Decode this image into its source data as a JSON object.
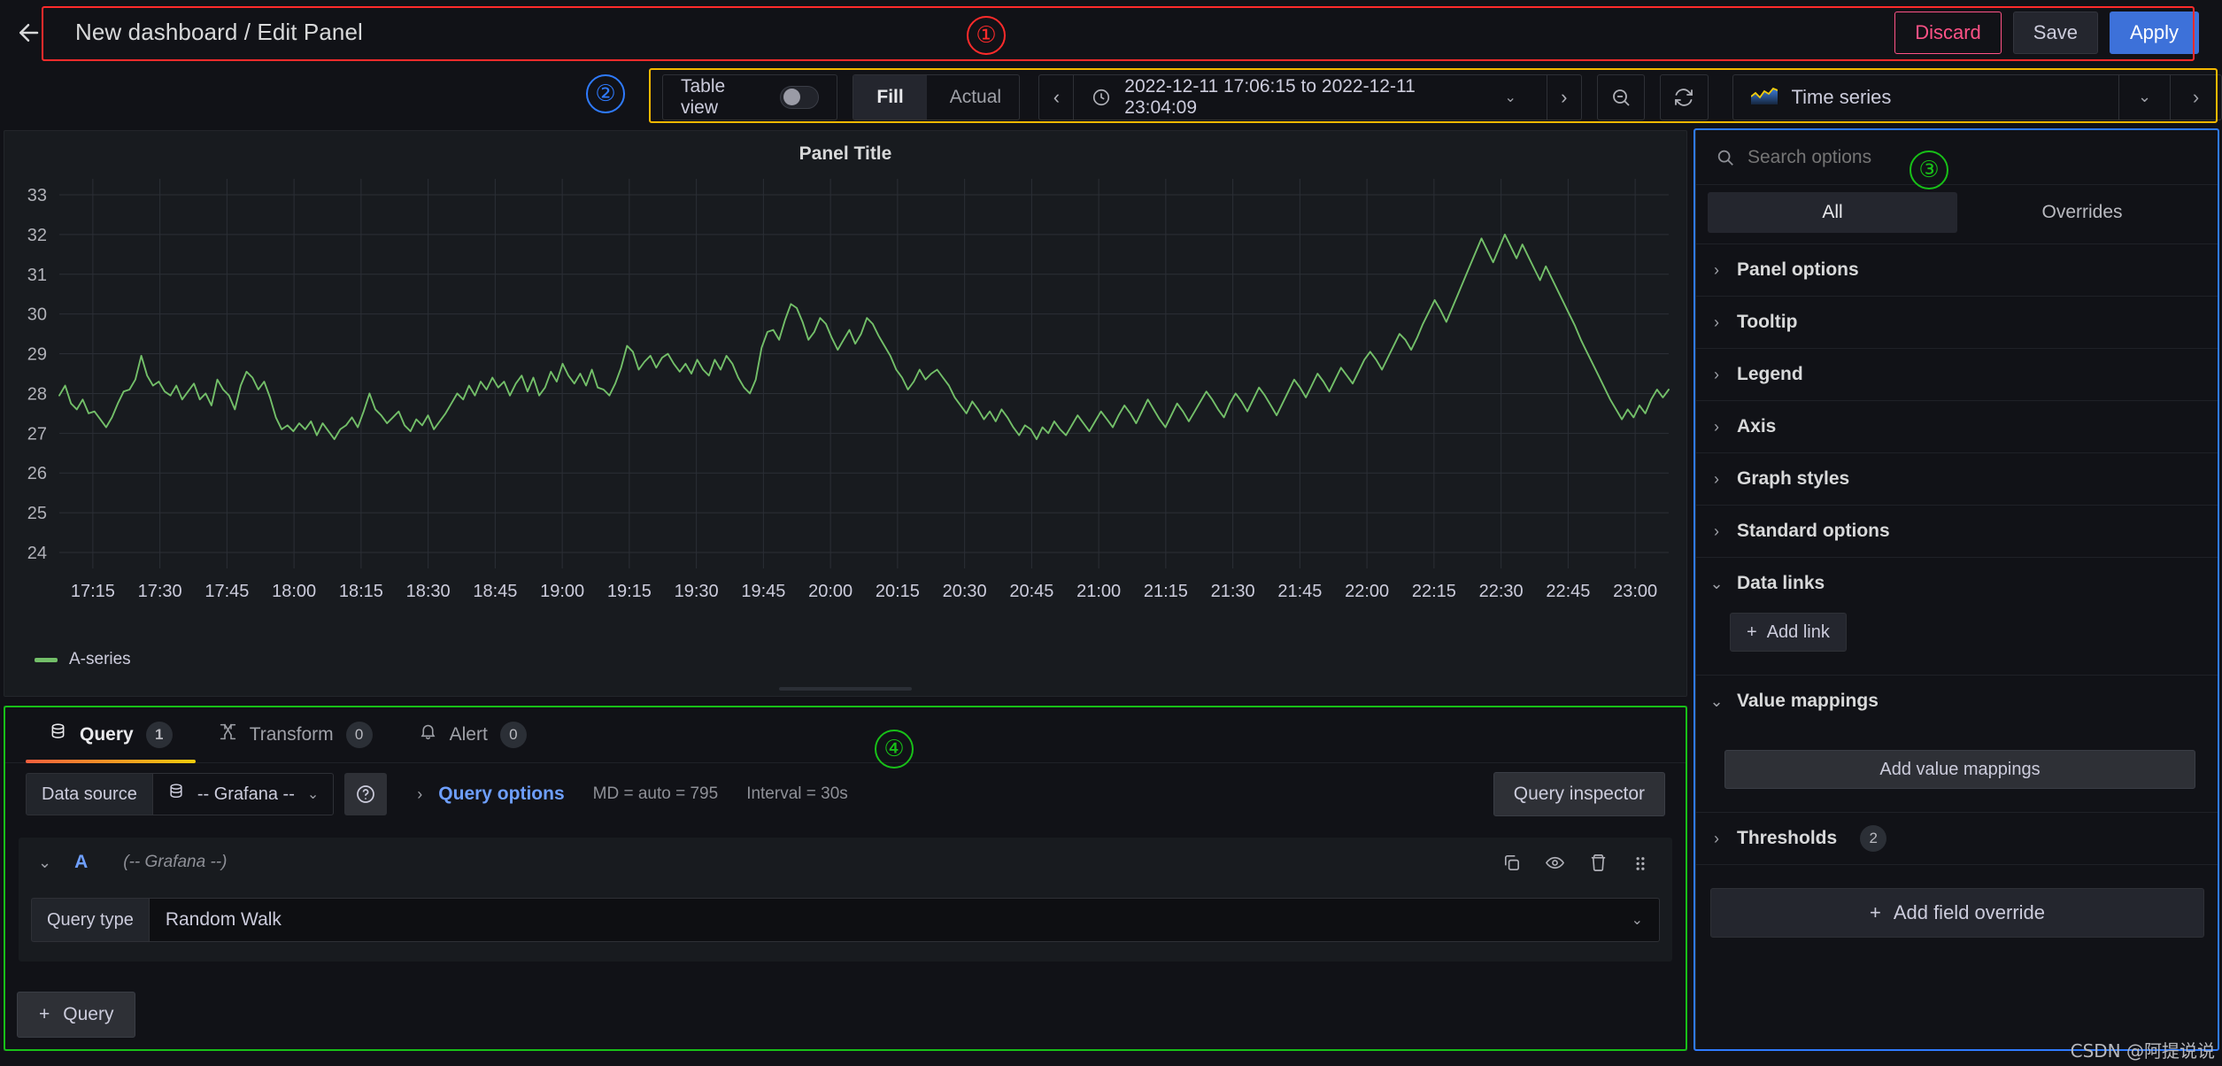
{
  "header": {
    "back_icon": "arrow-left-icon",
    "title": "New dashboard / Edit Panel",
    "discard_label": "Discard",
    "save_label": "Save",
    "apply_label": "Apply",
    "accent_apply": "#3d71d9",
    "accent_discard": "#ff5286"
  },
  "toolbar": {
    "table_view_label": "Table view",
    "table_view_on": false,
    "fill_label": "Fill",
    "actual_label": "Actual",
    "fill_active": true,
    "prev_arrow": "‹",
    "next_arrow": "›",
    "clock_icon": "clock-icon",
    "time_range": "2022-12-11 17:06:15 to 2022-12-11 23:04:09",
    "time_caret": "⌄",
    "zoom_out_icon": "zoom-out-icon",
    "refresh_icon": "refresh-icon",
    "viz_type": "Time series",
    "viz_icon": "timeseries-icon",
    "viz_caret": "⌄",
    "viz_next": "›"
  },
  "panel": {
    "title": "Panel Title"
  },
  "chart_data": {
    "type": "line",
    "title": "Panel Title",
    "xlabel": "",
    "ylabel": "",
    "ylim": [
      23.6,
      33.4
    ],
    "yticks": [
      24,
      25,
      26,
      27,
      28,
      29,
      30,
      31,
      32,
      33
    ],
    "xticks": [
      "17:15",
      "17:30",
      "17:45",
      "18:00",
      "18:15",
      "18:30",
      "18:45",
      "19:00",
      "19:15",
      "19:30",
      "19:45",
      "20:00",
      "20:15",
      "20:30",
      "20:45",
      "21:00",
      "21:15",
      "21:30",
      "21:45",
      "22:00",
      "22:15",
      "22:30",
      "22:45",
      "23:00"
    ],
    "grid": true,
    "legend_position": "bottom-left",
    "series": [
      {
        "name": "A-series",
        "color": "#73bf69",
        "values": [
          27.95,
          28.2,
          27.75,
          27.6,
          27.85,
          27.5,
          27.55,
          27.35,
          27.15,
          27.4,
          27.75,
          28.05,
          28.1,
          28.35,
          28.95,
          28.45,
          28.2,
          28.3,
          28.05,
          27.95,
          28.2,
          27.85,
          28.05,
          28.25,
          27.85,
          28.0,
          27.7,
          28.35,
          28.1,
          27.95,
          27.6,
          28.2,
          28.55,
          28.4,
          28.1,
          28.3,
          27.9,
          27.4,
          27.1,
          27.2,
          27.05,
          27.25,
          27.1,
          27.3,
          26.95,
          27.25,
          27.05,
          26.85,
          27.1,
          27.2,
          27.4,
          27.15,
          27.55,
          28.0,
          27.6,
          27.45,
          27.25,
          27.4,
          27.55,
          27.2,
          27.05,
          27.35,
          27.2,
          27.45,
          27.1,
          27.3,
          27.5,
          27.75,
          28.0,
          27.85,
          28.2,
          27.95,
          28.3,
          28.1,
          28.4,
          28.15,
          28.3,
          27.95,
          28.25,
          28.45,
          28.05,
          28.4,
          27.95,
          28.15,
          28.55,
          28.3,
          28.75,
          28.45,
          28.25,
          28.5,
          28.2,
          28.6,
          28.15,
          28.1,
          27.95,
          28.25,
          28.65,
          29.2,
          29.05,
          28.6,
          28.8,
          28.95,
          28.65,
          28.9,
          29.0,
          28.75,
          28.55,
          28.75,
          28.5,
          28.85,
          28.6,
          28.45,
          28.85,
          28.6,
          28.95,
          28.75,
          28.4,
          28.15,
          28.0,
          28.35,
          29.15,
          29.55,
          29.6,
          29.35,
          29.85,
          30.25,
          30.15,
          29.8,
          29.35,
          29.55,
          29.9,
          29.75,
          29.4,
          29.1,
          29.35,
          29.6,
          29.25,
          29.5,
          29.9,
          29.75,
          29.45,
          29.2,
          28.95,
          28.6,
          28.4,
          28.1,
          28.3,
          28.6,
          28.35,
          28.5,
          28.6,
          28.4,
          28.2,
          27.9,
          27.7,
          27.5,
          27.8,
          27.6,
          27.35,
          27.55,
          27.3,
          27.6,
          27.4,
          27.15,
          26.95,
          27.2,
          27.1,
          26.85,
          27.15,
          27.0,
          27.3,
          27.1,
          26.95,
          27.2,
          27.45,
          27.25,
          27.05,
          27.3,
          27.55,
          27.35,
          27.15,
          27.45,
          27.7,
          27.5,
          27.25,
          27.55,
          27.85,
          27.6,
          27.35,
          27.15,
          27.45,
          27.75,
          27.55,
          27.3,
          27.55,
          27.8,
          28.05,
          27.85,
          27.6,
          27.4,
          27.75,
          28.0,
          27.8,
          27.55,
          27.85,
          28.15,
          27.95,
          27.7,
          27.45,
          27.75,
          28.05,
          28.35,
          28.15,
          27.9,
          28.2,
          28.5,
          28.3,
          28.05,
          28.35,
          28.65,
          28.45,
          28.25,
          28.55,
          28.85,
          29.05,
          28.85,
          28.6,
          28.9,
          29.2,
          29.5,
          29.35,
          29.1,
          29.4,
          29.75,
          30.05,
          30.35,
          30.1,
          29.8,
          30.15,
          30.5,
          30.85,
          31.2,
          31.55,
          31.9,
          31.6,
          31.3,
          31.65,
          32.0,
          31.7,
          31.4,
          31.75,
          31.45,
          31.15,
          30.85,
          31.2,
          30.9,
          30.6,
          30.3,
          30.0,
          29.7,
          29.35,
          29.05,
          28.75,
          28.45,
          28.15,
          27.85,
          27.6,
          27.35,
          27.6,
          27.4,
          27.7,
          27.5,
          27.85,
          28.1,
          27.9,
          28.1
        ]
      }
    ]
  },
  "options": {
    "search_placeholder": "Search options",
    "search_value": "",
    "search_icon": "search-icon",
    "tab_all": "All",
    "tab_overrides": "Overrides",
    "active_tab": "All",
    "sections": [
      {
        "label": "Panel options",
        "expanded": false
      },
      {
        "label": "Tooltip",
        "expanded": false
      },
      {
        "label": "Legend",
        "expanded": false
      },
      {
        "label": "Axis",
        "expanded": false
      },
      {
        "label": "Graph styles",
        "expanded": false
      },
      {
        "label": "Standard options",
        "expanded": false
      },
      {
        "label": "Data links",
        "expanded": true,
        "button": "Add link"
      },
      {
        "label": "Value mappings",
        "expanded": true,
        "button": "Add value mappings"
      },
      {
        "label": "Thresholds",
        "expanded": false,
        "badge": "2"
      }
    ],
    "add_field_override": "Add field override"
  },
  "query_pane": {
    "tabs": [
      {
        "label": "Query",
        "count": "1",
        "icon": "database-icon",
        "active": true
      },
      {
        "label": "Transform",
        "count": "0",
        "icon": "transform-icon",
        "active": false
      },
      {
        "label": "Alert",
        "count": "0",
        "icon": "bell-icon",
        "active": false
      }
    ],
    "data_source_label": "Data source",
    "data_source_value": "-- Grafana --",
    "data_source_icon": "database-icon",
    "help_icon": "help-circle-icon",
    "query_options_label": "Query options",
    "query_options_caret": "›",
    "max_data_points": "MD = auto = 795",
    "interval": "Interval = 30s",
    "query_inspector_label": "Query inspector",
    "rows": [
      {
        "ref_id": "A",
        "data_source": "(-- Grafana --)",
        "query_type_label": "Query type",
        "query_type_value": "Random Walk",
        "actions": [
          "copy-icon",
          "eye-icon",
          "trash-icon",
          "drag-handle-icon"
        ]
      }
    ],
    "add_query_label": "Query",
    "add_query_plus": "+"
  },
  "annotations": [
    {
      "number": "①",
      "color": "#ff2b2b"
    },
    {
      "number": "②",
      "color": "#2f7bff"
    },
    {
      "number": "③",
      "color": "#18c018"
    },
    {
      "number": "④",
      "color": "#18c018"
    }
  ],
  "watermark": "CSDN @阿提说说"
}
